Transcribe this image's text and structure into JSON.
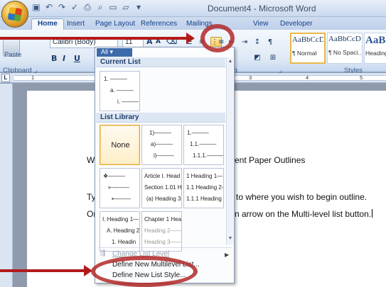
{
  "window": {
    "title": "Document4 - Microsoft Word"
  },
  "quick_access": [
    "save-icon",
    "undo-icon",
    "redo-icon",
    "spelling-icon",
    "print-icon",
    "print-preview-icon",
    "new-icon",
    "open-icon"
  ],
  "tabs": [
    {
      "label": "Home",
      "active": true
    },
    {
      "label": "Insert"
    },
    {
      "label": "Page Layout"
    },
    {
      "label": "References"
    },
    {
      "label": "Mailings"
    },
    {
      "label": "View"
    },
    {
      "label": "Developer"
    }
  ],
  "ribbon": {
    "clipboard": {
      "paste_label": "Paste",
      "group_label": "Clipboard"
    },
    "font": {
      "name": "Calibri (Body)",
      "size": "11",
      "bold": "B",
      "italic": "I",
      "underline": "U"
    },
    "paragraph": {
      "group_label": "aph"
    },
    "styles": {
      "group_label": "Styles",
      "tiles": [
        {
          "sample": "AaBbCcDc",
          "name": "¶ Normal",
          "selected": true
        },
        {
          "sample": "AaBbCcDc",
          "name": "¶ No Spaci..."
        },
        {
          "sample": "AaBb",
          "name": "Heading"
        }
      ]
    }
  },
  "ruler": {
    "corner": "L",
    "numbers": [
      "1",
      "3",
      "4",
      "5"
    ]
  },
  "document": {
    "line1_start": "W",
    "line1_end": "ent Paper Outlines",
    "line2_start": "Ty",
    "line2_end": "to where you wish to begin outline.",
    "line3_start": "Or",
    "line3_end": "n arrow on the Multi-level list button."
  },
  "menu": {
    "filter": "All ▾",
    "current_list_header": "Current List",
    "list_library_header": "List Library",
    "current_list": [
      "1. ———",
      "a. ———",
      "i. ———"
    ],
    "library": [
      {
        "type": "none",
        "label": "None"
      },
      {
        "lines": [
          "1)———",
          "a)———",
          "i)———"
        ]
      },
      {
        "lines": [
          "1.———",
          "1.1.———",
          "1.1.1.———"
        ]
      },
      {
        "lines": [
          "❖———",
          "➢———",
          "▪———"
        ]
      },
      {
        "lines": [
          "Article I. Head",
          "Section 1.01 H",
          "(a) Heading 3-"
        ]
      },
      {
        "lines": [
          "1 Heading 1—",
          "1.1 Heading 2—",
          "1.1.1 Heading"
        ]
      },
      {
        "lines": [
          "I. Heading 1—",
          "A. Heading 2",
          "1. Headin"
        ]
      },
      {
        "lines": [
          "Chapter 1 Hea",
          "Heading 2——",
          "Heading 3——"
        ]
      }
    ],
    "items": {
      "change_level": "Change List Level",
      "define_multilevel": "Define New Multilevel List...",
      "define_style": "Define New List Style..."
    }
  },
  "colors": {
    "annotation": "#b21a1a",
    "ribbon_accent": "#15428b"
  }
}
